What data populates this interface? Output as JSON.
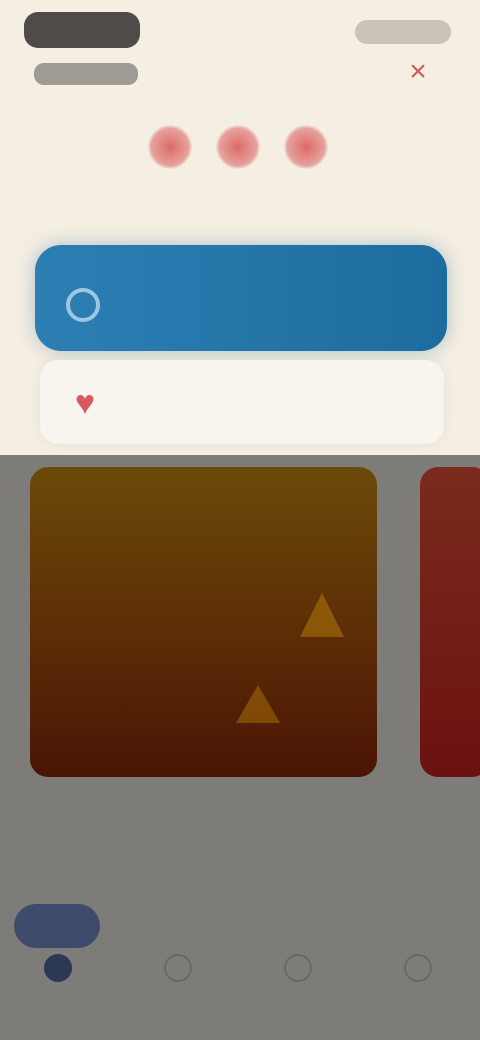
{
  "header": {
    "logo_label": "",
    "subtitle": "",
    "right_action_label": "",
    "close_icon": "close-icon"
  },
  "status": {
    "caption": ""
  },
  "action_cards": {
    "primary_label": "",
    "secondary_label": "",
    "primary_icon": "circle-icon",
    "secondary_icon": "heart-icon"
  },
  "feature": {
    "title": "",
    "peek_title": ""
  },
  "section": {
    "title": ""
  },
  "tabs": [
    {
      "label": "",
      "active": true
    },
    {
      "label": "",
      "active": false
    },
    {
      "label": "",
      "active": false
    },
    {
      "label": "",
      "active": false
    }
  ],
  "colors": {
    "accent_red": "#d75a5c",
    "primary_blue": "#1d6c9f",
    "background": "#f5eee2",
    "lower_background": "#7d7c78"
  }
}
